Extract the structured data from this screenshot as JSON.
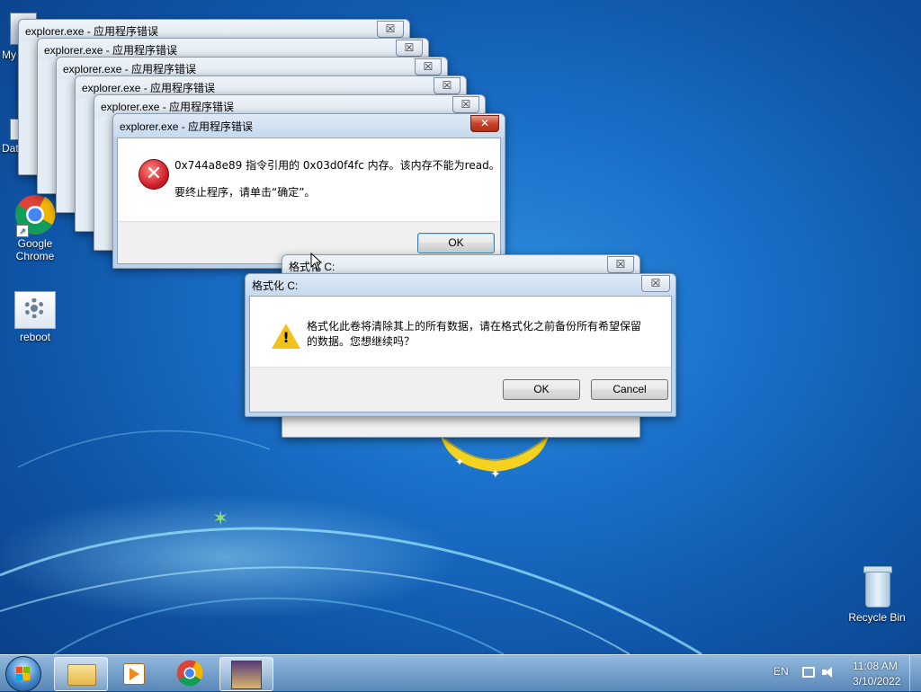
{
  "desktop": {
    "icons": [
      {
        "label": "My"
      },
      {
        "label": "Dat"
      },
      {
        "label": "Google Chrome"
      },
      {
        "label": "reboot"
      },
      {
        "label": "Recycle Bin"
      }
    ]
  },
  "error_stack": {
    "titles": [
      "explorer.exe - 应用程序错误",
      "explorer.exe - 应用程序错误",
      "explorer.exe - 应用程序错误",
      "explorer.exe - 应用程序错误",
      "explorer.exe - 应用程序错误"
    ],
    "close_glyph": "☒"
  },
  "error_dialog": {
    "title": "explorer.exe - 应用程序错误",
    "message_line1": "0x744a8e89 指令引用的 0x03d0f4fc 内存。该内存不能为read。",
    "message_line2": "要终止程序，请单击“确定”。",
    "ok_label": "OK",
    "close_glyph": "✕"
  },
  "format_back_dialog": {
    "title": "格式化 C:",
    "close_glyph": "☒"
  },
  "format_dialog": {
    "title": "格式化 C:",
    "message_line1": "格式化此卷将清除其上的所有数据，请在格式化之前备份所有希望保留",
    "message_line2": "的数据。您想继续吗？",
    "ok_label": "OK",
    "cancel_label": "Cancel",
    "close_glyph": "☒"
  },
  "taskbar": {
    "language": "EN",
    "time": "11:08 AM",
    "date": "3/10/2022"
  },
  "colors": {
    "accent": "#1a6fc8",
    "error_red": "#d0212c",
    "warning_yellow": "#f2c21b"
  }
}
